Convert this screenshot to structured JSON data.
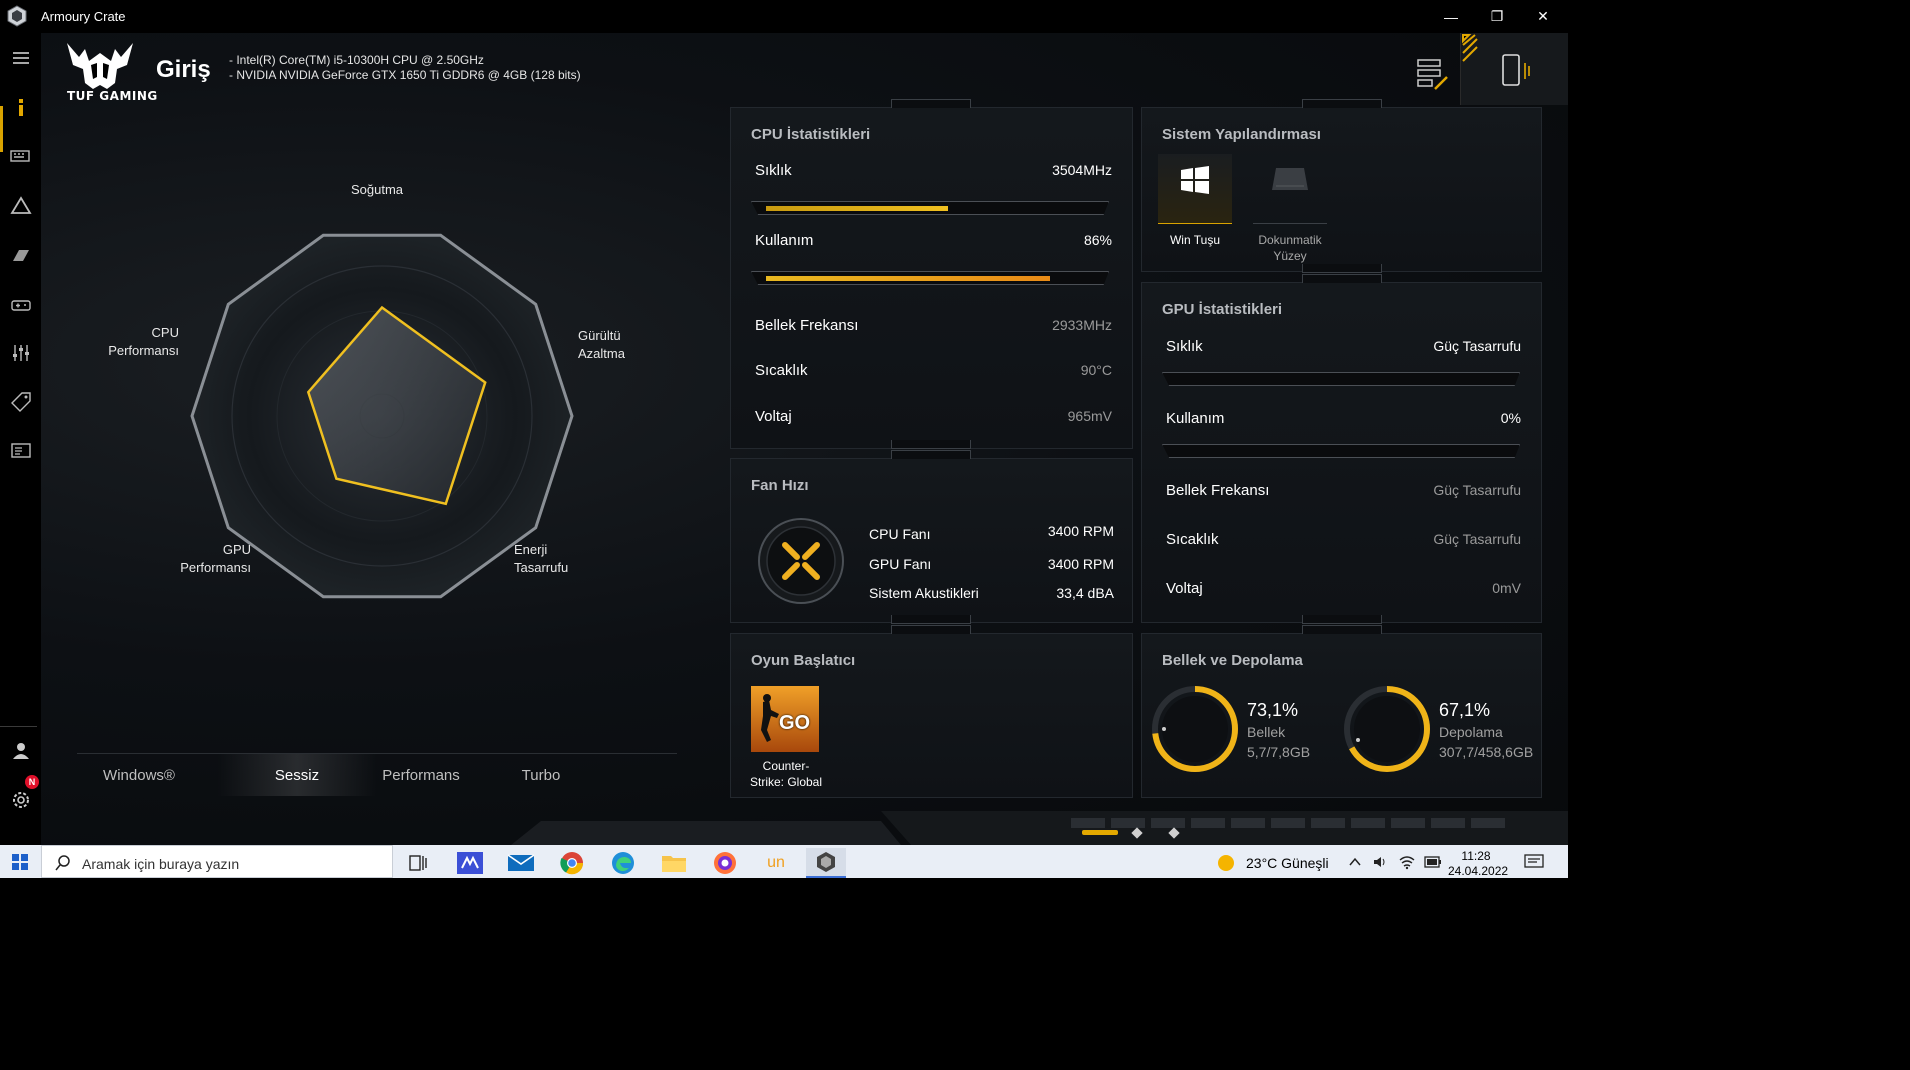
{
  "window": {
    "title": "Armoury Crate",
    "minimize": "—",
    "restore": "❐",
    "close": "✕"
  },
  "brand": {
    "logo_text": "TUF GAMING"
  },
  "header": {
    "title": "Giriş",
    "specs": [
      "-   Intel(R) Core(TM) i5-10300H CPU @ 2.50GHz",
      "-   NVIDIA NVIDIA GeForce GTX 1650 Ti GDDR6 @ 4GB (128 bits)"
    ]
  },
  "radar": {
    "labels": {
      "cooling": "Soğutma",
      "noise_line1": "Gürültü",
      "noise_line2": "Azaltma",
      "energy_line1": "Enerji",
      "energy_line2": "Tasarrufu",
      "gpu_line1": "GPU",
      "gpu_line2": "Performansı",
      "cpu_line1": "CPU",
      "cpu_line2": "Performansı"
    },
    "values": {
      "cooling": 0.7,
      "noise": 0.7,
      "energy": 0.7,
      "gpu": 0.5,
      "cpu": 0.5
    }
  },
  "modes": {
    "tabs": [
      "Windows®",
      "Sessiz",
      "Performans",
      "Turbo"
    ],
    "selected": "Sessiz"
  },
  "cpu_stats": {
    "title": "CPU İstatistikleri",
    "freq_label": "Sıklık",
    "freq_value": "3504MHz",
    "freq_level": 0.55,
    "usage_label": "Kullanım",
    "usage_value": "86%",
    "usage_level": 0.86,
    "mem_freq_label": "Bellek Frekansı",
    "mem_freq_value": "2933MHz",
    "temp_label": "Sıcaklık",
    "temp_value": "90°C",
    "volt_label": "Voltaj",
    "volt_value": "965mV"
  },
  "fan": {
    "title": "Fan Hızı",
    "cpu_label": "CPU Fanı",
    "cpu_value": "3400 RPM",
    "gpu_label": "GPU Fanı",
    "gpu_value": "3400 RPM",
    "acoustic_label": "Sistem Akustikleri",
    "acoustic_value": "33,4 dBA"
  },
  "launcher": {
    "title": "Oyun Başlatıcı",
    "game_line1": "Counter-",
    "game_line2": "Strike: Global",
    "tile_text": "GO"
  },
  "sys_config": {
    "title": "Sistem Yapılandırması",
    "win_key_label": "Win Tuşu",
    "touchpad_line1": "Dokunmatik",
    "touchpad_line2": "Yüzey"
  },
  "gpu_stats": {
    "title": "GPU İstatistikleri",
    "freq_label": "Sıklık",
    "freq_value": "Güç Tasarrufu",
    "usage_label": "Kullanım",
    "usage_value": "0%",
    "mem_freq_label": "Bellek Frekansı",
    "mem_freq_value": "Güç Tasarrufu",
    "temp_label": "Sıcaklık",
    "temp_value": "Güç Tasarrufu",
    "volt_label": "Voltaj",
    "volt_value": "0mV"
  },
  "storage": {
    "title": "Bellek ve Depolama",
    "memory_pct": "73,1%",
    "memory_label": "Bellek",
    "memory_detail": "5,7/7,8GB",
    "memory_level": 0.731,
    "disk_pct": "67,1%",
    "disk_label": "Depolama",
    "disk_detail": "307,7/458,6GB",
    "disk_level": 0.671
  },
  "rail": {
    "icons": [
      "hamburger-icon",
      "info-icon",
      "keyboard-icon",
      "aura-icon",
      "gamevisual-icon",
      "controller-icon",
      "mixer-icon",
      "tag-icon",
      "screen-icon",
      "user-icon",
      "settings-icon"
    ],
    "badge": "N"
  },
  "taskbar": {
    "search_placeholder": "Aramak için buraya yazın",
    "weather": "23°C  Güneşli",
    "time": "11:28",
    "date": "24.04.2022"
  },
  "colors": {
    "accent": "#f0c020",
    "accent_orange": "#e98b17",
    "panel_bg": "#14181c"
  }
}
